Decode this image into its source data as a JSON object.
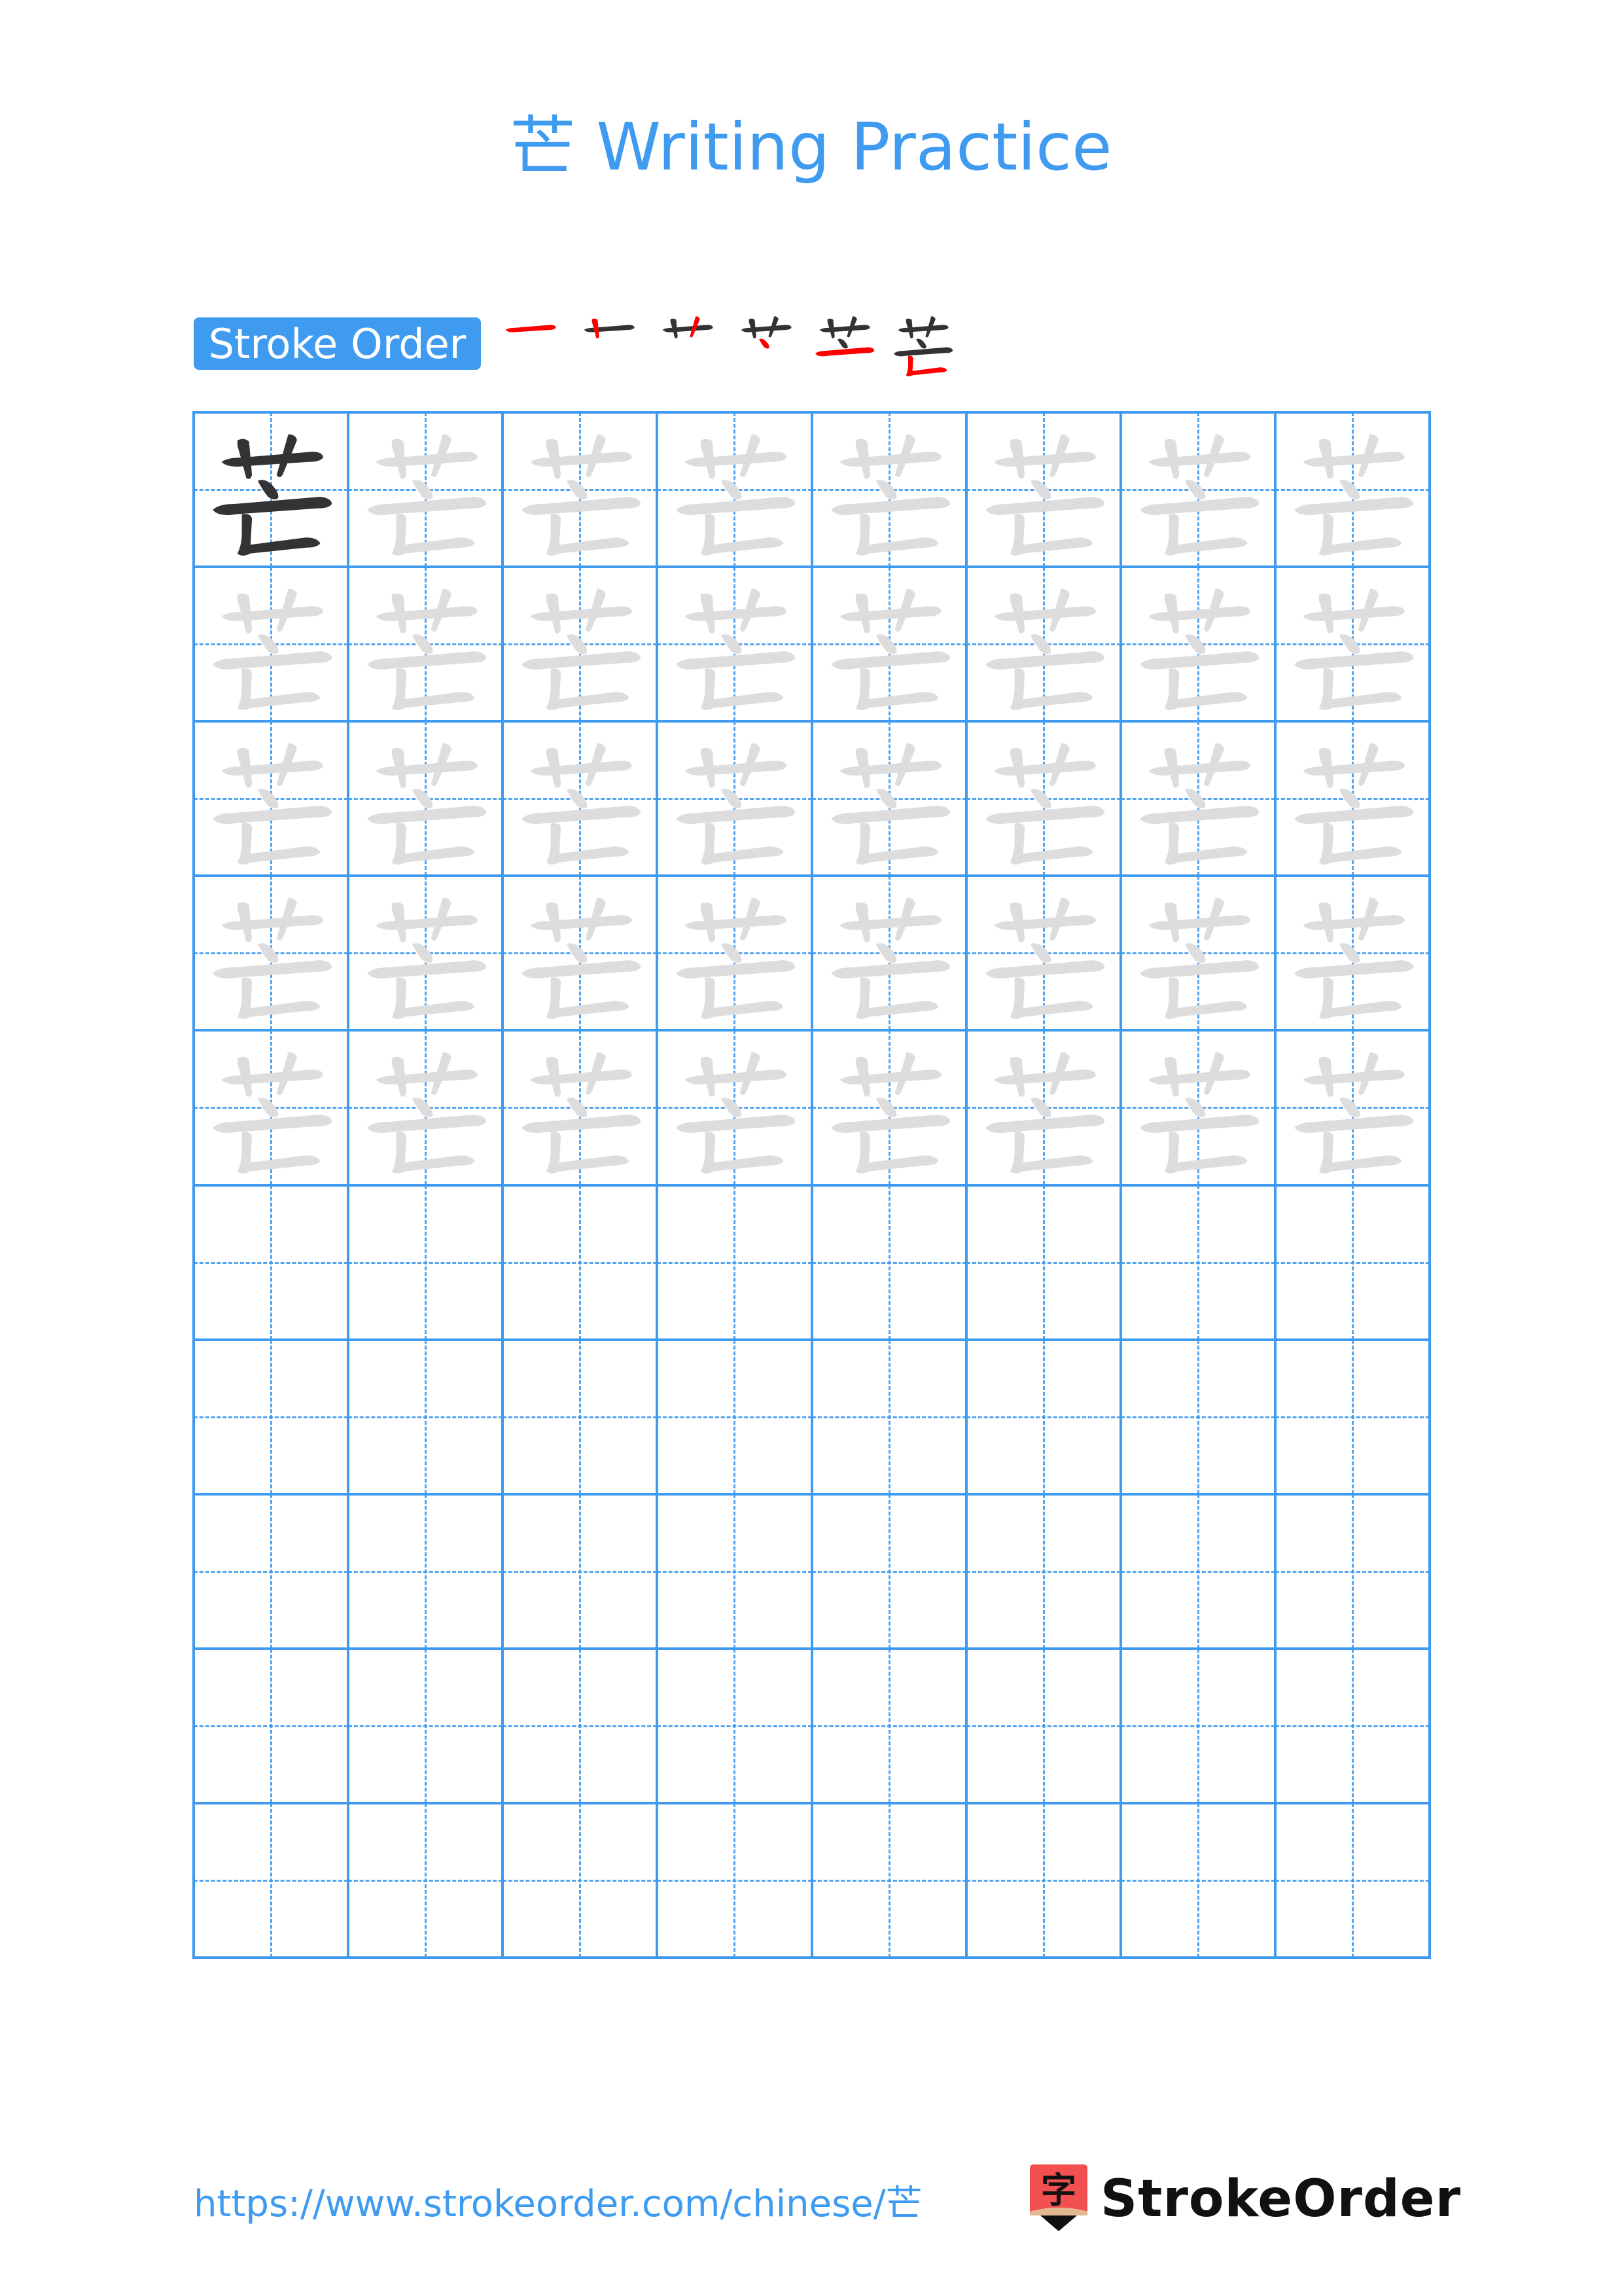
{
  "header": {
    "character": "芒",
    "title_suffix": "Writing Practice"
  },
  "stroke_order": {
    "badge_label": "Stroke Order",
    "stroke_count": 6,
    "active_color": "#ff0000",
    "done_color": "#333333"
  },
  "practice_grid": {
    "rows": 10,
    "columns": 8,
    "model_cell_character": "芒",
    "trace_rows": 5,
    "blank_rows": 5,
    "grid_color": "#3f9bf0",
    "model_color": "#333333",
    "trace_color": "#dddddd"
  },
  "footer": {
    "url": "https://www.strokeorder.com/chinese/芒",
    "logo_glyph": "字",
    "logo_text": "StrokeOrder",
    "logo_colors": {
      "red": "#f25050",
      "tan": "#e0b98f",
      "dark": "#111111"
    }
  }
}
